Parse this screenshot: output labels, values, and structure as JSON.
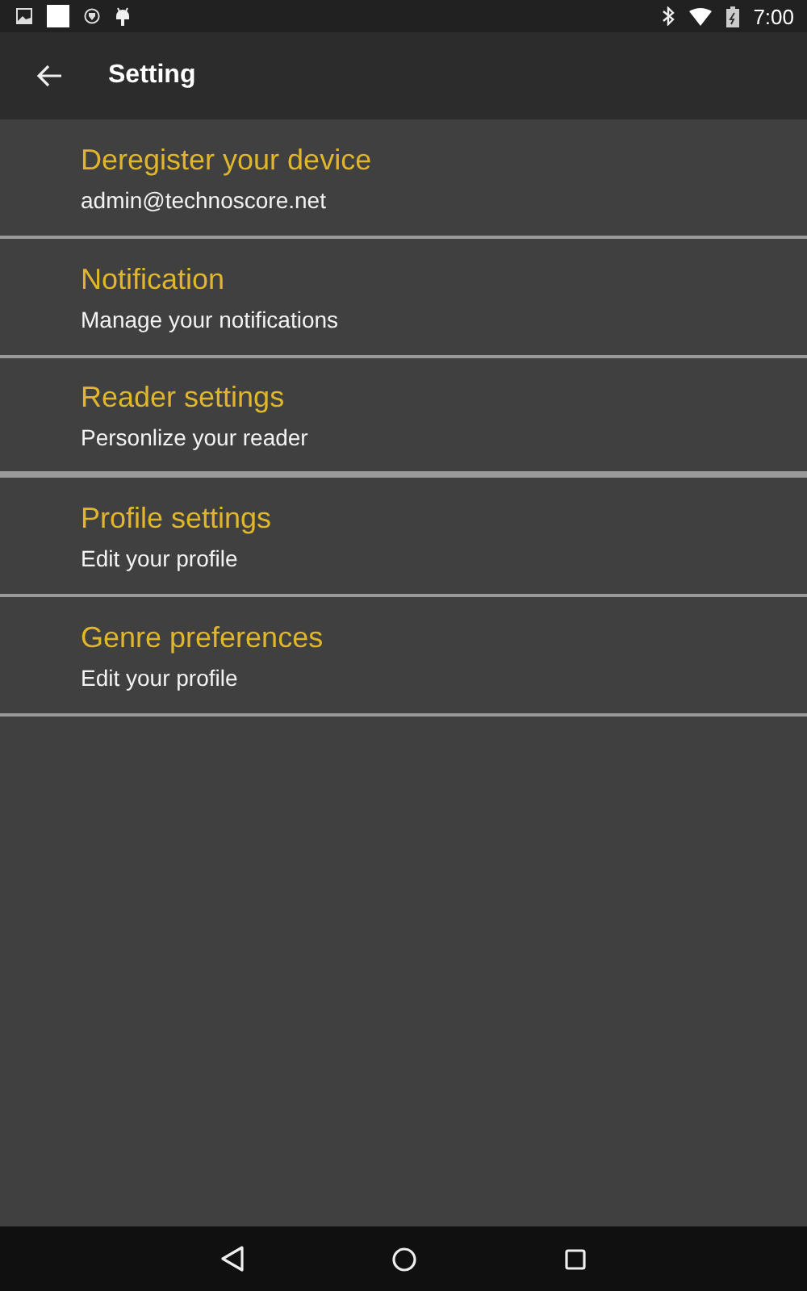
{
  "status_bar": {
    "time": "7:00"
  },
  "toolbar": {
    "title": "Setting"
  },
  "settings": [
    {
      "title": "Deregister your device",
      "subtitle": "admin@technoscore.net"
    },
    {
      "title": "Notification",
      "subtitle": "Manage your notifications"
    },
    {
      "title": "Reader settings",
      "subtitle": "Personlize your reader"
    },
    {
      "title": "Profile settings",
      "subtitle": "Edit your profile"
    },
    {
      "title": "Genre preferences",
      "subtitle": "Edit your profile"
    }
  ]
}
